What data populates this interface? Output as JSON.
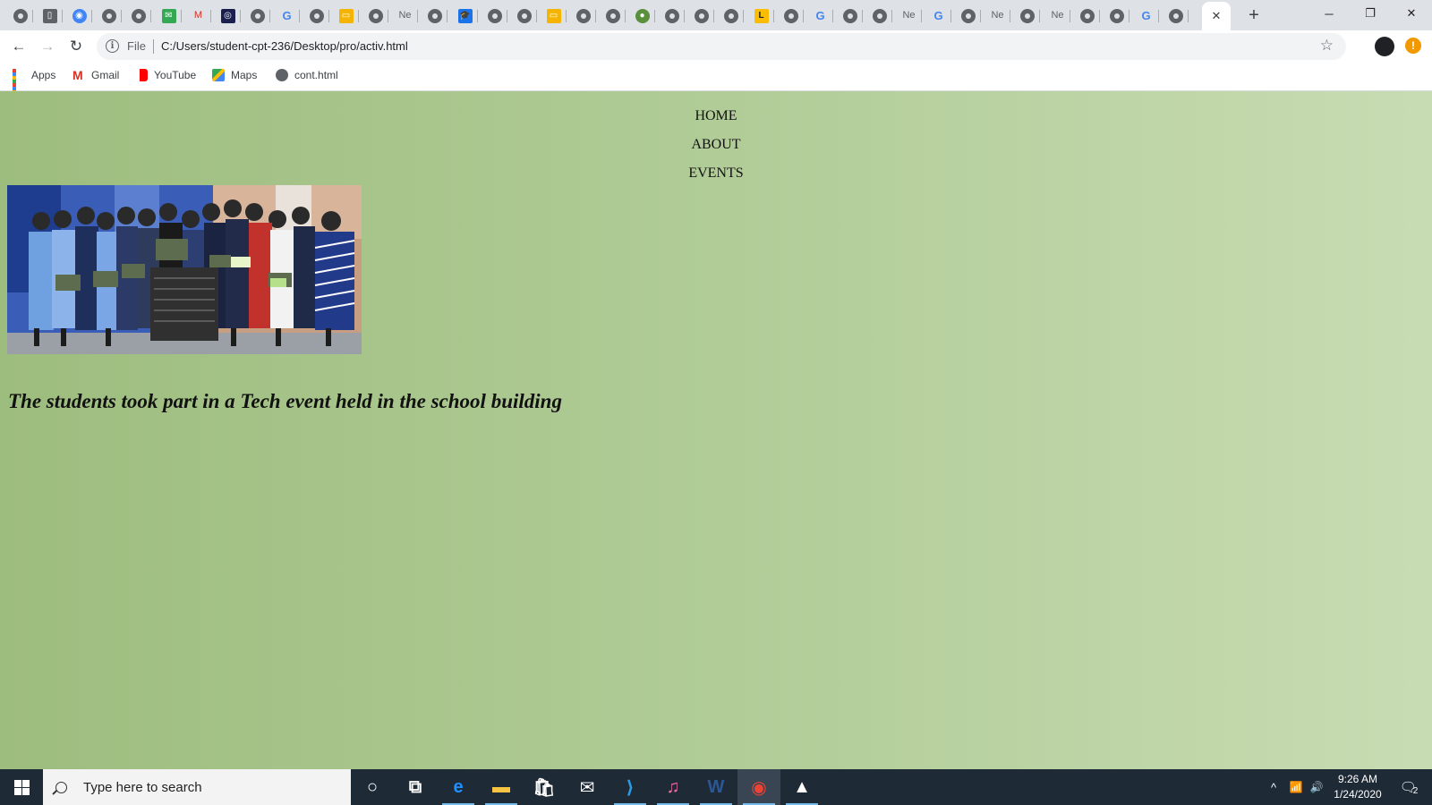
{
  "browser": {
    "tabs": [
      {
        "icon": "globe-icon",
        "kind": "globe"
      },
      {
        "icon": "document-icon",
        "kind": "sq",
        "color": "#5f6368",
        "glyph": "▯"
      },
      {
        "icon": "circle-icon",
        "kind": "circle",
        "color": "#4285f4",
        "glyph": "◉"
      },
      {
        "icon": "globe-icon",
        "kind": "globe"
      },
      {
        "icon": "globe-icon",
        "kind": "globe"
      },
      {
        "icon": "whatsapp-icon",
        "kind": "sq",
        "color": "#34a853",
        "glyph": "✉"
      },
      {
        "icon": "gmail-icon",
        "kind": "txt",
        "color": "#d93025",
        "glyph": "M"
      },
      {
        "icon": "dark-app-icon",
        "kind": "sq",
        "color": "#1a1f4d",
        "glyph": "◎"
      },
      {
        "icon": "globe-icon",
        "kind": "globe"
      },
      {
        "icon": "google-icon",
        "kind": "txt",
        "color": "#4285f4",
        "glyph": "G"
      },
      {
        "icon": "globe-icon",
        "kind": "globe"
      },
      {
        "icon": "slides-icon",
        "kind": "sq",
        "color": "#f4b400",
        "glyph": "▭"
      },
      {
        "icon": "globe-icon",
        "kind": "globe"
      },
      {
        "icon": "newtab-icon",
        "kind": "txt",
        "color": "#5f6368",
        "glyph": "Ne"
      },
      {
        "icon": "globe-icon",
        "kind": "globe"
      },
      {
        "icon": "graduation-cap-icon",
        "kind": "sq",
        "color": "#1a73e8",
        "glyph": "🎓"
      },
      {
        "icon": "globe-icon",
        "kind": "globe"
      },
      {
        "icon": "globe-icon",
        "kind": "globe"
      },
      {
        "icon": "slides-icon",
        "kind": "sq",
        "color": "#f4b400",
        "glyph": "▭"
      },
      {
        "icon": "globe-icon",
        "kind": "globe"
      },
      {
        "icon": "globe-icon",
        "kind": "globe"
      },
      {
        "icon": "green-app-icon",
        "kind": "circle",
        "color": "#5a8f3c",
        "glyph": "●"
      },
      {
        "icon": "globe-icon",
        "kind": "globe"
      },
      {
        "icon": "globe-icon",
        "kind": "globe"
      },
      {
        "icon": "globe-icon",
        "kind": "globe"
      },
      {
        "icon": "lightning-icon",
        "kind": "sq",
        "color": "#fbbc04",
        "glyph": "L"
      },
      {
        "icon": "globe-icon",
        "kind": "globe"
      },
      {
        "icon": "google-icon",
        "kind": "txt",
        "color": "#4285f4",
        "glyph": "G"
      },
      {
        "icon": "globe-icon",
        "kind": "globe"
      },
      {
        "icon": "globe-icon",
        "kind": "globe"
      },
      {
        "icon": "newtab-icon",
        "kind": "txt",
        "color": "#5f6368",
        "glyph": "Ne"
      },
      {
        "icon": "google-icon",
        "kind": "txt",
        "color": "#4285f4",
        "glyph": "G"
      },
      {
        "icon": "globe-icon",
        "kind": "globe"
      },
      {
        "icon": "newtab-icon",
        "kind": "txt",
        "color": "#5f6368",
        "glyph": "Ne"
      },
      {
        "icon": "globe-icon",
        "kind": "globe"
      },
      {
        "icon": "newtab-icon",
        "kind": "txt",
        "color": "#5f6368",
        "glyph": "Ne"
      },
      {
        "icon": "globe-icon",
        "kind": "globe"
      },
      {
        "icon": "globe-icon",
        "kind": "globe"
      },
      {
        "icon": "google-icon",
        "kind": "txt",
        "color": "#4285f4",
        "glyph": "G"
      },
      {
        "icon": "globe-icon",
        "kind": "globe"
      }
    ],
    "active_tab_close": "✕",
    "new_tab": "+",
    "window_controls": {
      "minimize": "─",
      "restore": "❐",
      "close": "✕"
    },
    "nav": {
      "back": "←",
      "forward": "→",
      "reload": "↻"
    },
    "address": {
      "scheme_label": "File",
      "url": "C:/Users/student-cpt-236/Desktop/pro/activ.html",
      "info_glyph": "i",
      "star": "☆"
    },
    "alert_glyph": "!"
  },
  "bookmarks": [
    {
      "label": "Apps",
      "icon": "apps-grid-icon"
    },
    {
      "label": "Gmail",
      "icon": "gmail-icon"
    },
    {
      "label": "YouTube",
      "icon": "youtube-icon"
    },
    {
      "label": "Maps",
      "icon": "maps-icon"
    },
    {
      "label": "cont.html",
      "icon": "globe-icon"
    }
  ],
  "page": {
    "menu": [
      "HOME",
      "ABOUT",
      "EVENTS"
    ],
    "caption": "The students took part in a Tech event held in the school building",
    "background_colors": [
      "#9dbd7e",
      "#c8dcb3"
    ]
  },
  "taskbar": {
    "search_placeholder": "Type here to search",
    "apps": [
      {
        "name": "cortana-icon",
        "glyph": "○",
        "running": false
      },
      {
        "name": "task-view-icon",
        "glyph": "⧉",
        "running": false
      },
      {
        "name": "edge-icon",
        "glyph": "e",
        "running": true,
        "color": "#1e90ff"
      },
      {
        "name": "file-explorer-icon",
        "glyph": "▬",
        "running": true,
        "color": "#f6c343"
      },
      {
        "name": "store-icon",
        "glyph": "🛍",
        "running": false
      },
      {
        "name": "mail-icon",
        "glyph": "✉",
        "running": false
      },
      {
        "name": "vscode-icon",
        "glyph": "⟩",
        "running": true,
        "color": "#2b9be6"
      },
      {
        "name": "itunes-icon",
        "glyph": "♫",
        "running": true,
        "color": "#f06aa0"
      },
      {
        "name": "word-icon",
        "glyph": "W",
        "running": true,
        "color": "#2b5797"
      },
      {
        "name": "chrome-icon",
        "glyph": "◉",
        "running": true,
        "focused": true,
        "color": "#ea4335"
      },
      {
        "name": "photos-icon",
        "glyph": "▲",
        "running": true,
        "color": "#ffffff"
      }
    ],
    "tray": {
      "chevron": "^",
      "network": "📶",
      "volume": "🔊",
      "notifications": "🗨",
      "notification_count": "2"
    },
    "time": "9:26 AM",
    "date": "1/24/2020"
  }
}
